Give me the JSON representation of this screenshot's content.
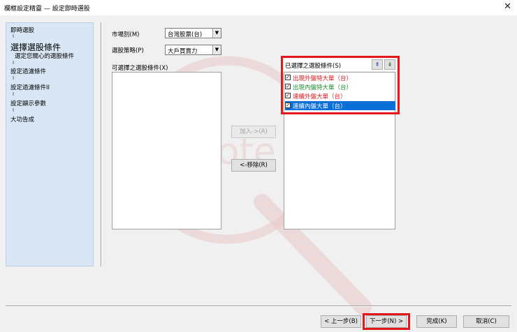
{
  "window": {
    "title": "欄框設定精靈 — 設定即時選股",
    "close_glyph": "✕"
  },
  "sidebar": {
    "step1": "即時選股",
    "step2": "選擇選股條件",
    "step2_sub": "選定您關心的選股條件",
    "step3": "設定過濾條件",
    "step4": "設定過濾條件II",
    "step5": "設定顯示參數",
    "step6": "大功告成",
    "connector": "I"
  },
  "form": {
    "market_label": "市場別(M)",
    "market_value": "台灣股票(台)",
    "strategy_label": "選股策略(P)",
    "strategy_value": "大戶買賣力",
    "available_label": "可選擇之選股條件(X)",
    "add_button": "加入->(A)",
    "remove_button": "<-移除(R)",
    "selected_label": "已選擇之選股條件(S)",
    "move_up_glyph": "⇞",
    "move_down_glyph": "⇟",
    "selected_items": [
      {
        "label": "出現外盤特大單（台）",
        "checked": true,
        "color": "#e3161a"
      },
      {
        "label": "出現內盤特大單（台）",
        "checked": true,
        "color": "#1a8c2a"
      },
      {
        "label": "連續外盤大單（台）",
        "checked": true,
        "color": "#e3161a"
      },
      {
        "label": "連續內盤大單（台）",
        "checked": true,
        "color": "#ffffff"
      }
    ],
    "check_glyph": "✓"
  },
  "footer": {
    "back_button": "< 上一步(B)",
    "next_button": "下一步(N) >",
    "finish_button": "完成(K)",
    "cancel_button": "取消(C)"
  },
  "colors": {
    "highlight": "#e3161a",
    "selection": "#0a6fd6"
  }
}
